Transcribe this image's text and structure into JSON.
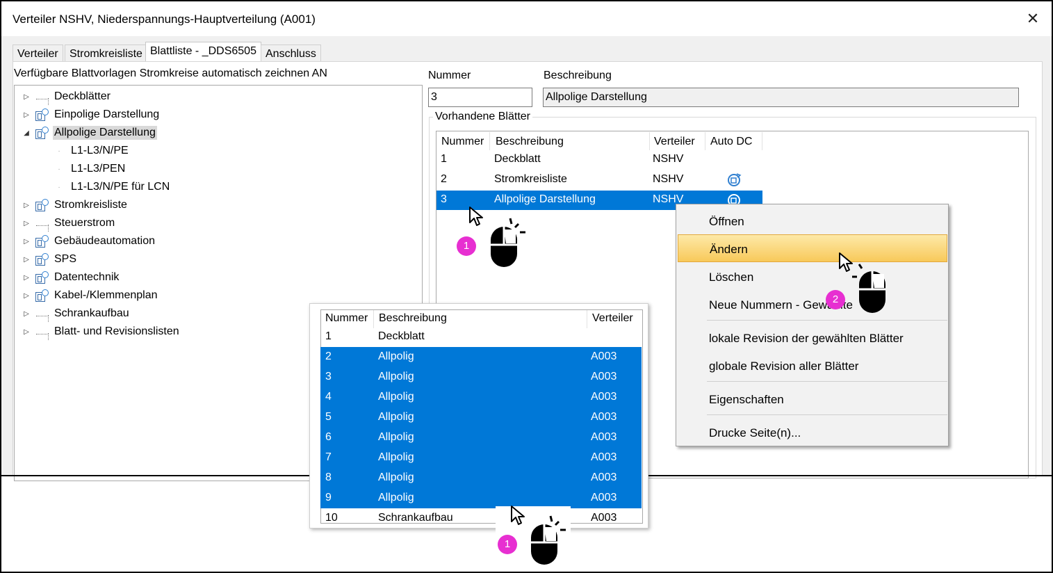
{
  "window": {
    "title": "Verteiler NSHV, Niederspannungs-Hauptverteilung (A001)",
    "close_glyph": "✕"
  },
  "tabs": [
    "Verteiler",
    "Stromkreisliste",
    "Blattliste - _DDS6505",
    "Anschluss"
  ],
  "active_tab": "Blattliste - _DDS6505",
  "tree": {
    "label": "Verfügbare Blattvorlagen Stromkreise automatisch zeichnen AN",
    "items": [
      {
        "label": "Deckblätter",
        "icon": "dotted-node-icon",
        "expanded": false
      },
      {
        "label": "Einpolige Darstellung",
        "icon": "sheet-template-icon",
        "expanded": false
      },
      {
        "label": "Allpolige Darstellung",
        "icon": "sheet-template-icon",
        "expanded": true,
        "selected": true
      },
      {
        "label": "L1-L3/N/PE",
        "child": true
      },
      {
        "label": "L1-L3/PEN",
        "child": true
      },
      {
        "label": "L1-L3/N/PE für LCN",
        "child": true
      },
      {
        "label": "Stromkreisliste",
        "icon": "sheet-template-icon",
        "expanded": false
      },
      {
        "label": "Steuerstrom",
        "icon": "dotted-node-icon",
        "expanded": false
      },
      {
        "label": "Gebäudeautomation",
        "icon": "sheet-template-icon",
        "expanded": false
      },
      {
        "label": "SPS",
        "icon": "sheet-template-icon",
        "expanded": false
      },
      {
        "label": "Datentechnik",
        "icon": "sheet-template-icon",
        "expanded": false
      },
      {
        "label": "Kabel-/Klemmenplan",
        "icon": "sheet-template-icon",
        "expanded": false
      },
      {
        "label": "Schrankaufbau",
        "icon": "dotted-node-icon",
        "expanded": false
      },
      {
        "label": "Blatt- und Revisionslisten",
        "icon": "dotted-node-icon",
        "expanded": false
      }
    ]
  },
  "form": {
    "nummer_label": "Nummer",
    "nummer_value": "3",
    "beschreibung_label": "Beschreibung",
    "beschreibung_value": "Allpolige Darstellung"
  },
  "sheets": {
    "group_title": "Vorhandene Blätter",
    "columns": [
      "Nummer",
      "Beschreibung",
      "Verteiler",
      "Auto DC"
    ],
    "rows": [
      {
        "nummer": "1",
        "beschreibung": "Deckblatt",
        "verteiler": "NSHV",
        "auto_dc": false
      },
      {
        "nummer": "2",
        "beschreibung": "Stromkreisliste",
        "verteiler": "NSHV",
        "auto_dc": true
      },
      {
        "nummer": "3",
        "beschreibung": "Allpolige Darstellung",
        "verteiler": "NSHV",
        "auto_dc": true,
        "selected": true
      }
    ]
  },
  "context_menu": {
    "items": [
      {
        "label": "Öffnen"
      },
      {
        "label": "Ändern",
        "highlighted": true
      },
      {
        "label": "Löschen"
      },
      {
        "label": "Neue Nummern - Gewählte"
      },
      {
        "label": "lokale Revision der gewählten Blätter"
      },
      {
        "label": "globale Revision aller Blätter"
      },
      {
        "label": "Eigenschaften"
      },
      {
        "label": "Drucke Seite(n)..."
      }
    ]
  },
  "popup_list": {
    "columns": [
      "Nummer",
      "Beschreibung",
      "Verteiler"
    ],
    "rows": [
      {
        "nummer": "1",
        "beschreibung": "Deckblatt",
        "verteiler": ""
      },
      {
        "nummer": "2",
        "beschreibung": "Allpolig",
        "verteiler": "A003",
        "selected": true
      },
      {
        "nummer": "3",
        "beschreibung": "Allpolig",
        "verteiler": "A003",
        "selected": true
      },
      {
        "nummer": "4",
        "beschreibung": "Allpolig",
        "verteiler": "A003",
        "selected": true
      },
      {
        "nummer": "5",
        "beschreibung": "Allpolig",
        "verteiler": "A003",
        "selected": true
      },
      {
        "nummer": "6",
        "beschreibung": "Allpolig",
        "verteiler": "A003",
        "selected": true
      },
      {
        "nummer": "7",
        "beschreibung": "Allpolig",
        "verteiler": "A003",
        "selected": true
      },
      {
        "nummer": "8",
        "beschreibung": "Allpolig",
        "verteiler": "A003",
        "selected": true
      },
      {
        "nummer": "9",
        "beschreibung": "Allpolig",
        "verteiler": "A003",
        "selected": true
      },
      {
        "nummer": "10",
        "beschreibung": "Schrankaufbau",
        "verteiler": "A003"
      }
    ]
  },
  "annotations": {
    "badge_1": "1",
    "badge_2": "2",
    "badge_color": "#e72fd1",
    "selection_color": "#0078d7"
  }
}
